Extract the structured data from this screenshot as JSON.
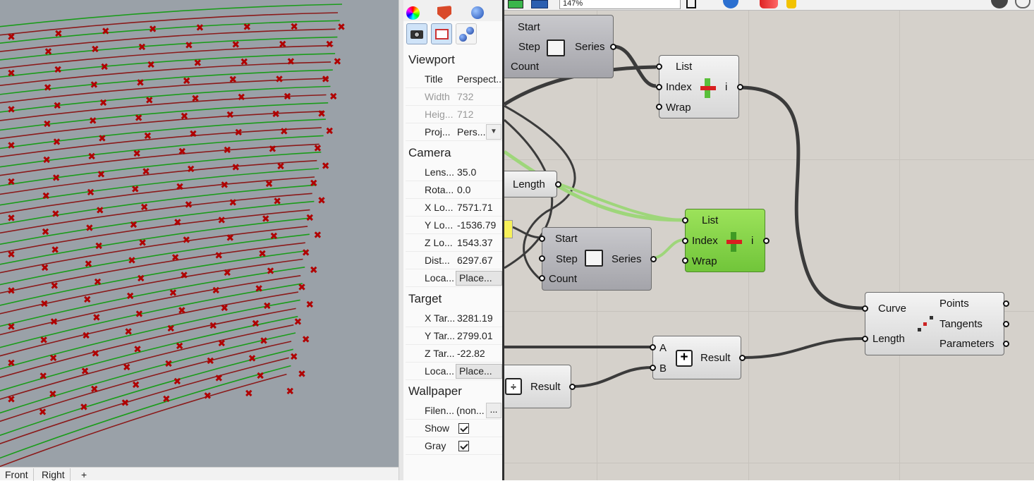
{
  "viewport_tabs": [
    "Front",
    "Right"
  ],
  "add_tab_glyph": "+",
  "properties": {
    "tab_icons": [
      "color-wheel-icon",
      "shield-icon",
      "material-sphere-icon"
    ],
    "tool_icons": [
      "camera-icon",
      "frame-icon",
      "sun-icon"
    ],
    "sections": {
      "viewport": {
        "header": "Viewport",
        "title_label": "Title",
        "title_value": "Perspect...",
        "width_label": "Width",
        "width_value": "732",
        "height_label": "Heig...",
        "height_value": "712",
        "projection_label": "Proj...",
        "projection_value": "Pers..."
      },
      "camera": {
        "header": "Camera",
        "lens_label": "Lens...",
        "lens_value": "35.0",
        "rotation_label": "Rota...",
        "rotation_value": "0.0",
        "x_label": "X Lo...",
        "x_value": "7571.71",
        "y_label": "Y Lo...",
        "y_value": "-1536.79",
        "z_label": "Z Lo...",
        "z_value": "1543.37",
        "dist_label": "Dist...",
        "dist_value": "6297.67",
        "loc_label": "Loca...",
        "place_label": "Place..."
      },
      "target": {
        "header": "Target",
        "x_label": "X Tar...",
        "x_value": "3281.19",
        "y_label": "Y Tar...",
        "y_value": "2799.01",
        "z_label": "Z Tar...",
        "z_value": "-22.82",
        "loc_label": "Loca...",
        "place_label": "Place..."
      },
      "wallpaper": {
        "header": "Wallpaper",
        "file_label": "Filen...",
        "file_value": "(non...",
        "browse_label": "...",
        "show_label": "Show",
        "show_checked": true,
        "gray_label": "Gray",
        "gray_checked": true
      }
    }
  },
  "grasshopper": {
    "zoom": "147%",
    "series1": {
      "in": [
        "Start",
        "Step",
        "Count"
      ],
      "out": "Series"
    },
    "list1": {
      "in": [
        "List",
        "Index",
        "Wrap"
      ],
      "out": "i"
    },
    "length_param": "Length",
    "series2": {
      "in": [
        "Start",
        "Step",
        "Count"
      ],
      "out": "Series"
    },
    "list2": {
      "in": [
        "List",
        "Index",
        "Wrap"
      ],
      "out": "i"
    },
    "divide": {
      "in": [
        "Curve",
        "Length"
      ],
      "out": [
        "Points",
        "Tangents",
        "Parameters"
      ]
    },
    "addition": {
      "in": [
        "A",
        "B"
      ],
      "out": "Result"
    },
    "division_result": "Result"
  },
  "colors": {
    "viewport_bg": "#9aa1a8",
    "green_curve": "#1a9c1a",
    "red_curve": "#8b1a1a",
    "point_marker": "#b00000",
    "canvas_bg": "#d5d1cb",
    "green_component": "#8ad44e",
    "selected_wire": "#9ed67a"
  }
}
